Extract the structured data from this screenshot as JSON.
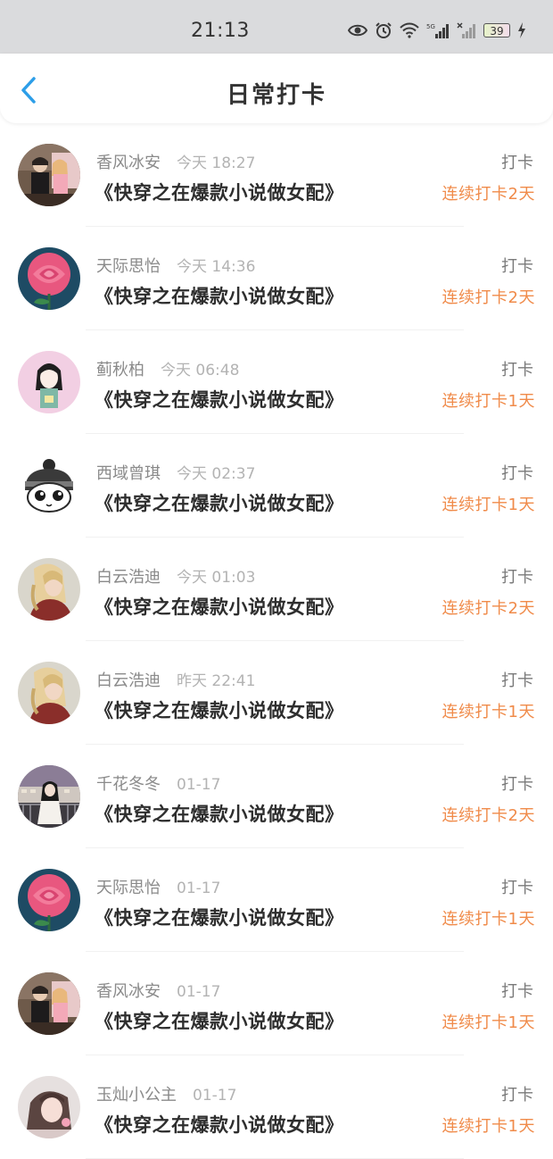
{
  "status_bar": {
    "time": "21:13",
    "battery": "39"
  },
  "header": {
    "title": "日常打卡"
  },
  "items": [
    {
      "name": "香风冰安",
      "time": "今天 18:27",
      "book": "《快穿之在爆款小说做女配》",
      "action": "打卡",
      "streak": "连续打卡2天",
      "avatar": "avatar-couple"
    },
    {
      "name": "天际思怡",
      "time": "今天 14:36",
      "book": "《快穿之在爆款小说做女配》",
      "action": "打卡",
      "streak": "连续打卡2天",
      "avatar": "avatar-rose"
    },
    {
      "name": "蓟秋柏",
      "time": "今天 06:48",
      "book": "《快穿之在爆款小说做女配》",
      "action": "打卡",
      "streak": "连续打卡1天",
      "avatar": "avatar-girl-pink"
    },
    {
      "name": "西域曾琪",
      "time": "今天 02:37",
      "book": "《快穿之在爆款小说做女配》",
      "action": "打卡",
      "streak": "连续打卡1天",
      "avatar": "avatar-cartoon"
    },
    {
      "name": "白云浩迪",
      "time": "今天 01:03",
      "book": "《快穿之在爆款小说做女配》",
      "action": "打卡",
      "streak": "连续打卡2天",
      "avatar": "avatar-blonde-girl"
    },
    {
      "name": "白云浩迪",
      "time": "昨天 22:41",
      "book": "《快穿之在爆款小说做女配》",
      "action": "打卡",
      "streak": "连续打卡1天",
      "avatar": "avatar-blonde-girl"
    },
    {
      "name": "千花冬冬",
      "time": "01-17",
      "book": "《快穿之在爆款小说做女配》",
      "action": "打卡",
      "streak": "连续打卡2天",
      "avatar": "avatar-balcony-girl"
    },
    {
      "name": "天际思怡",
      "time": "01-17",
      "book": "《快穿之在爆款小说做女配》",
      "action": "打卡",
      "streak": "连续打卡1天",
      "avatar": "avatar-rose"
    },
    {
      "name": "香风冰安",
      "time": "01-17",
      "book": "《快穿之在爆款小说做女配》",
      "action": "打卡",
      "streak": "连续打卡1天",
      "avatar": "avatar-couple"
    },
    {
      "name": "玉灿小公主",
      "time": "01-17",
      "book": "《快穿之在爆款小说做女配》",
      "action": "打卡",
      "streak": "连续打卡1天",
      "avatar": "avatar-soft-girl"
    }
  ],
  "colors": {
    "accent": "#2d9ee8",
    "streak": "#f08b4a",
    "status_bar_bg": "#dadbdd"
  }
}
